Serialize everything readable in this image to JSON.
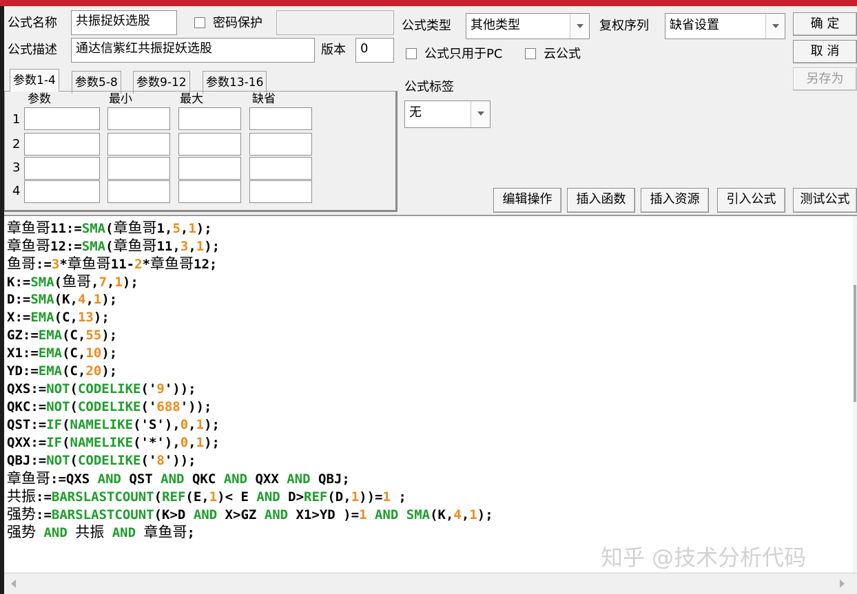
{
  "header": {
    "name_label": "公式名称",
    "name_value": "共振捉妖选股",
    "password_label": "密码保护",
    "password_value": "",
    "desc_label": "公式描述",
    "desc_value": "通达信紫红共振捉妖选股",
    "version_label": "版本",
    "version_value": "0",
    "type_label": "公式类型",
    "type_value": "其他类型",
    "fq_label": "复权序列",
    "fq_value": "缺省设置",
    "pc_only_label": "公式只用于PC",
    "cloud_label": "云公式",
    "tag_label": "公式标签",
    "tag_value": "无"
  },
  "buttons": {
    "ok": "确  定",
    "cancel": "取  消",
    "save_as": "另存为",
    "edit_ops": "编辑操作",
    "insert_func": "插入函数",
    "insert_res": "插入资源",
    "import_formula": "引入公式",
    "test_formula": "测试公式"
  },
  "tabs": [
    "参数1-4",
    "参数5-8",
    "参数9-12",
    "参数13-16"
  ],
  "params": {
    "col_headers": [
      "参数",
      "最小",
      "最大",
      "缺省"
    ],
    "rows": [
      "1",
      "2",
      "3",
      "4"
    ]
  },
  "code": [
    [
      [
        "cn",
        "章鱼哥"
      ],
      [
        "t",
        "11:="
      ],
      [
        "fn",
        "SMA"
      ],
      [
        "t",
        "("
      ],
      [
        "cn",
        "章鱼哥"
      ],
      [
        "t",
        "1,"
      ],
      [
        "num",
        "5"
      ],
      [
        "t",
        ","
      ],
      [
        "num",
        "1"
      ],
      [
        "t",
        ");"
      ]
    ],
    [
      [
        "cn",
        "章鱼哥"
      ],
      [
        "t",
        "12:="
      ],
      [
        "fn",
        "SMA"
      ],
      [
        "t",
        "("
      ],
      [
        "cn",
        "章鱼哥"
      ],
      [
        "t",
        "11,"
      ],
      [
        "num",
        "3"
      ],
      [
        "t",
        ","
      ],
      [
        "num",
        "1"
      ],
      [
        "t",
        ");"
      ]
    ],
    [
      [
        "cn",
        "鱼哥"
      ],
      [
        "t",
        ":="
      ],
      [
        "num",
        "3"
      ],
      [
        "t",
        "*"
      ],
      [
        "cn",
        "章鱼哥"
      ],
      [
        "t",
        "11-"
      ],
      [
        "num",
        "2"
      ],
      [
        "t",
        "*"
      ],
      [
        "cn",
        "章鱼哥"
      ],
      [
        "t",
        "12;"
      ]
    ],
    [
      [
        "t",
        "K:="
      ],
      [
        "fn",
        "SMA"
      ],
      [
        "t",
        "("
      ],
      [
        "cn",
        "鱼哥"
      ],
      [
        "t",
        ","
      ],
      [
        "num",
        "7"
      ],
      [
        "t",
        ","
      ],
      [
        "num",
        "1"
      ],
      [
        "t",
        ");"
      ]
    ],
    [
      [
        "t",
        "D:="
      ],
      [
        "fn",
        "SMA"
      ],
      [
        "t",
        "(K,"
      ],
      [
        "num",
        "4"
      ],
      [
        "t",
        ","
      ],
      [
        "num",
        "1"
      ],
      [
        "t",
        ");"
      ]
    ],
    [
      [
        "t",
        "X:="
      ],
      [
        "fn",
        "EMA"
      ],
      [
        "t",
        "(C,"
      ],
      [
        "num",
        "13"
      ],
      [
        "t",
        ");"
      ]
    ],
    [
      [
        "t",
        "GZ:="
      ],
      [
        "fn",
        "EMA"
      ],
      [
        "t",
        "(C,"
      ],
      [
        "num",
        "55"
      ],
      [
        "t",
        ");"
      ]
    ],
    [
      [
        "t",
        "X1:="
      ],
      [
        "fn",
        "EMA"
      ],
      [
        "t",
        "(C,"
      ],
      [
        "num",
        "10"
      ],
      [
        "t",
        ");"
      ]
    ],
    [
      [
        "t",
        "YD:="
      ],
      [
        "fn",
        "EMA"
      ],
      [
        "t",
        "(C,"
      ],
      [
        "num",
        "20"
      ],
      [
        "t",
        ");"
      ]
    ],
    [
      [
        "t",
        "QXS:="
      ],
      [
        "fn",
        "NOT"
      ],
      [
        "t",
        "("
      ],
      [
        "fn",
        "CODELIKE"
      ],
      [
        "t",
        "('"
      ],
      [
        "str",
        "9"
      ],
      [
        "t",
        "'));"
      ]
    ],
    [
      [
        "t",
        "QKC:="
      ],
      [
        "fn",
        "NOT"
      ],
      [
        "t",
        "("
      ],
      [
        "fn",
        "CODELIKE"
      ],
      [
        "t",
        "('"
      ],
      [
        "str",
        "688"
      ],
      [
        "t",
        "'));"
      ]
    ],
    [
      [
        "t",
        "QST:="
      ],
      [
        "fn",
        "IF"
      ],
      [
        "t",
        "("
      ],
      [
        "fn",
        "NAMELIKE"
      ],
      [
        "t",
        "('S'),"
      ],
      [
        "num",
        "0"
      ],
      [
        "t",
        ","
      ],
      [
        "num",
        "1"
      ],
      [
        "t",
        ");"
      ]
    ],
    [
      [
        "t",
        "QXX:="
      ],
      [
        "fn",
        "IF"
      ],
      [
        "t",
        "("
      ],
      [
        "fn",
        "NAMELIKE"
      ],
      [
        "t",
        "('*'),"
      ],
      [
        "num",
        "0"
      ],
      [
        "t",
        ","
      ],
      [
        "num",
        "1"
      ],
      [
        "t",
        ");"
      ]
    ],
    [
      [
        "t",
        "QBJ:="
      ],
      [
        "fn",
        "NOT"
      ],
      [
        "t",
        "("
      ],
      [
        "fn",
        "CODELIKE"
      ],
      [
        "t",
        "('"
      ],
      [
        "str",
        "8"
      ],
      [
        "t",
        "'));"
      ]
    ],
    [
      [
        "cn",
        "章鱼哥"
      ],
      [
        "t",
        ":=QXS "
      ],
      [
        "kw",
        "AND"
      ],
      [
        "t",
        " QST "
      ],
      [
        "kw",
        "AND"
      ],
      [
        "t",
        " QKC "
      ],
      [
        "kw",
        "AND"
      ],
      [
        "t",
        " QXX "
      ],
      [
        "kw",
        "AND"
      ],
      [
        "t",
        " QBJ;"
      ]
    ],
    [
      [
        "cn",
        "共振"
      ],
      [
        "t",
        ":="
      ],
      [
        "fn",
        "BARSLASTCOUNT"
      ],
      [
        "t",
        "("
      ],
      [
        "fn",
        "REF"
      ],
      [
        "t",
        "(E,"
      ],
      [
        "num",
        "1"
      ],
      [
        "t",
        ")< E "
      ],
      [
        "kw",
        "AND"
      ],
      [
        "t",
        " D>"
      ],
      [
        "fn",
        "REF"
      ],
      [
        "t",
        "(D,"
      ],
      [
        "num",
        "1"
      ],
      [
        "t",
        "))="
      ],
      [
        "num",
        "1"
      ],
      [
        "t",
        " ;"
      ]
    ],
    [
      [
        "cn",
        "强势"
      ],
      [
        "t",
        ":="
      ],
      [
        "fn",
        "BARSLASTCOUNT"
      ],
      [
        "t",
        "(K>D "
      ],
      [
        "kw",
        "AND"
      ],
      [
        "t",
        " X>GZ "
      ],
      [
        "kw",
        "AND"
      ],
      [
        "t",
        " X1>YD )="
      ],
      [
        "num",
        "1"
      ],
      [
        "t",
        " "
      ],
      [
        "kw",
        "AND"
      ],
      [
        "t",
        " "
      ],
      [
        "fn",
        "SMA"
      ],
      [
        "t",
        "(K,"
      ],
      [
        "num",
        "4"
      ],
      [
        "t",
        ","
      ],
      [
        "num",
        "1"
      ],
      [
        "t",
        ");"
      ]
    ],
    [
      [
        "cn",
        "强势"
      ],
      [
        "t",
        " "
      ],
      [
        "kw",
        "AND"
      ],
      [
        "t",
        " "
      ],
      [
        "cn",
        "共振"
      ],
      [
        "t",
        " "
      ],
      [
        "kw",
        "AND"
      ],
      [
        "t",
        " "
      ],
      [
        "cn",
        "章鱼哥"
      ],
      [
        "t",
        ";"
      ]
    ]
  ],
  "watermark": "知乎 @技术分析代码",
  "colors": {
    "title_bar": "#c8232c",
    "function": "#1e9e2b",
    "number": "#f08a1a"
  }
}
